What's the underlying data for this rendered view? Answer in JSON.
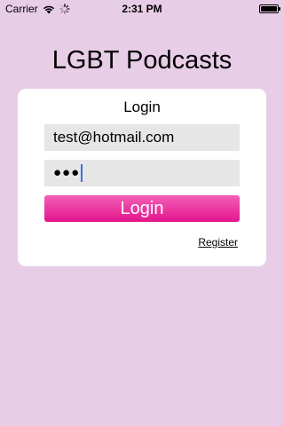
{
  "status_bar": {
    "carrier": "Carrier",
    "time": "2:31 PM",
    "icons": [
      "wifi-icon",
      "activity-spinner-icon",
      "battery-icon"
    ]
  },
  "app": {
    "title": "LGBT Podcasts"
  },
  "login_card": {
    "title": "Login",
    "email_value": "test@hotmail.com",
    "password_masked": "●●●",
    "login_button_label": "Login",
    "register_link_label": "Register"
  },
  "colors": {
    "background": "#e8cde6",
    "card": "#ffffff",
    "field_background": "#e6e6e6",
    "button_gradient_top": "#f45fb8",
    "button_gradient_bottom": "#e3158c",
    "caret": "#3b6fe8"
  }
}
